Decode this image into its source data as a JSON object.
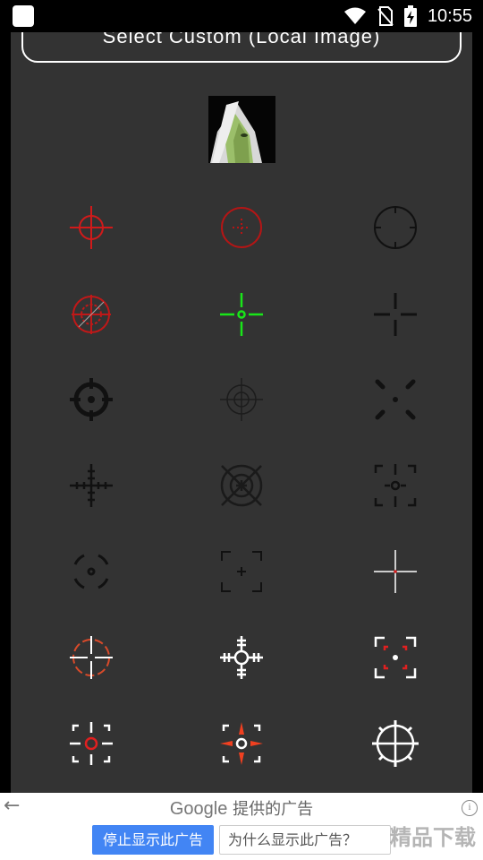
{
  "status_bar": {
    "time": "10:55"
  },
  "header": {
    "select_button_label": "Select Custom (Local Image)"
  },
  "ad": {
    "brand": "Google",
    "title_suffix": "提供的广告",
    "stop_label": "停止显示此广告",
    "why_label": "为什么显示此广告？",
    "info_glyph": "i",
    "watermark": "精品下载"
  },
  "colors": {
    "panel": "#333333",
    "red": "#d11a1a",
    "green": "#19e619",
    "dark": "#111111",
    "white": "#ffffff"
  },
  "crosshairs": [
    [
      "red-circle-crosshair",
      "red-dotted-circle-crosshair",
      "black-circle-ticks-crosshair"
    ],
    [
      "red-target-x-crosshair",
      "green-gap-crosshair",
      "black-plus-gap-crosshair"
    ],
    [
      "black-bold-ring-crosshair",
      "gray-scope-crosshair",
      "black-corner-dashes-crosshair"
    ],
    [
      "black-ticked-plus-crosshair",
      "dark-x-ring-crosshair",
      "black-bracket-dot-crosshair"
    ],
    [
      "black-broken-ring-crosshair",
      "black-corner-bracket-crosshair",
      "white-thin-plus-crosshair"
    ],
    [
      "white-red-circle-crosshair",
      "white-ornate-crosshair",
      "white-red-bracket-crosshair"
    ],
    [
      "white-red-ring-crosshair",
      "white-red-arrow-crosshair",
      "white-gear-crosshair"
    ]
  ]
}
